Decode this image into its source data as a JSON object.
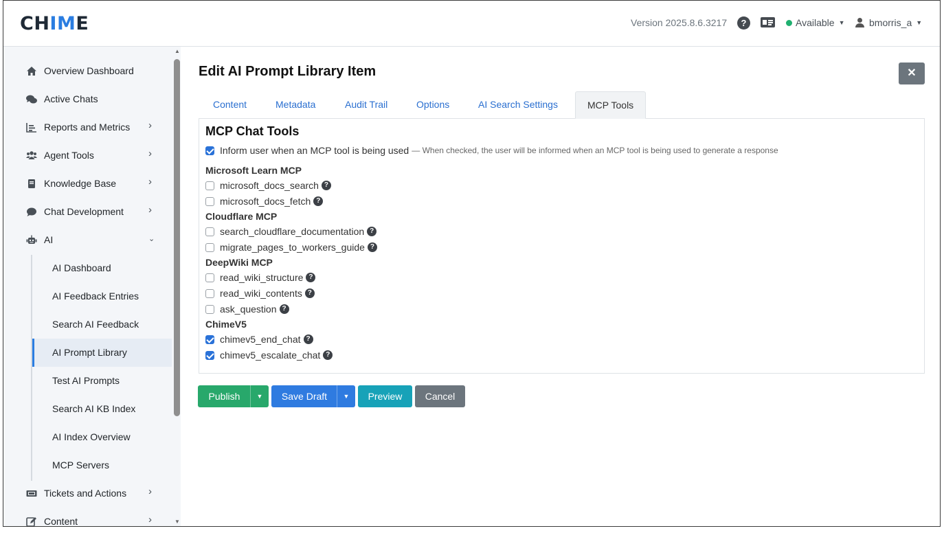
{
  "header": {
    "logo_pre": "CH",
    "logo_hl": "IM",
    "logo_post": "E",
    "version": "Version 2025.8.6.3217",
    "help": "?",
    "status": "Available",
    "user": "bmorris_a"
  },
  "sidebar": {
    "items": [
      {
        "label": "Overview Dashboard",
        "icon": "home-icon"
      },
      {
        "label": "Active Chats",
        "icon": "chats-icon"
      },
      {
        "label": "Reports and Metrics",
        "icon": "chart-icon"
      },
      {
        "label": "Agent Tools",
        "icon": "users-icon"
      },
      {
        "label": "Knowledge Base",
        "icon": "book-icon"
      },
      {
        "label": "Chat Development",
        "icon": "comment-icon"
      },
      {
        "label": "AI",
        "icon": "robot-icon"
      },
      {
        "label": "Tickets and Actions",
        "icon": "ticket-icon"
      },
      {
        "label": "Content",
        "icon": "edit-icon"
      }
    ],
    "ai_sub": [
      "AI Dashboard",
      "AI Feedback Entries",
      "Search AI Feedback",
      "AI Prompt Library",
      "Test AI Prompts",
      "Search AI KB Index",
      "AI Index Overview",
      "MCP Servers"
    ],
    "active_sub": "AI Prompt Library"
  },
  "main": {
    "title": "Edit AI Prompt Library Item",
    "close": "✕",
    "tabs": [
      "Content",
      "Metadata",
      "Audit Trail",
      "Options",
      "AI Search Settings",
      "MCP Tools"
    ],
    "active_tab": "MCP Tools"
  },
  "mcp": {
    "title": "MCP Chat Tools",
    "inform_label": "Inform user when an MCP tool is being used",
    "inform_desc": "— When checked, the user will be informed when an MCP tool is being used to generate a response",
    "inform_checked": true,
    "groups": [
      {
        "name": "Microsoft Learn MCP",
        "tools": [
          {
            "name": "microsoft_docs_search",
            "checked": false
          },
          {
            "name": "microsoft_docs_fetch",
            "checked": false
          }
        ]
      },
      {
        "name": "Cloudflare MCP",
        "tools": [
          {
            "name": "search_cloudflare_documentation",
            "checked": false
          },
          {
            "name": "migrate_pages_to_workers_guide",
            "checked": false
          }
        ]
      },
      {
        "name": "DeepWiki MCP",
        "tools": [
          {
            "name": "read_wiki_structure",
            "checked": false
          },
          {
            "name": "read_wiki_contents",
            "checked": false
          },
          {
            "name": "ask_question",
            "checked": false
          }
        ]
      },
      {
        "name": "ChimeV5",
        "tools": [
          {
            "name": "chimev5_end_chat",
            "checked": true
          },
          {
            "name": "chimev5_escalate_chat",
            "checked": true
          }
        ]
      }
    ]
  },
  "actions": {
    "publish": "Publish",
    "save_draft": "Save Draft",
    "preview": "Preview",
    "cancel": "Cancel"
  },
  "colors": {
    "publish": "#28a86b",
    "save_draft": "#2f7be0",
    "preview": "#17a2b8",
    "cancel": "#6c757d",
    "accent": "#2a7de1"
  }
}
